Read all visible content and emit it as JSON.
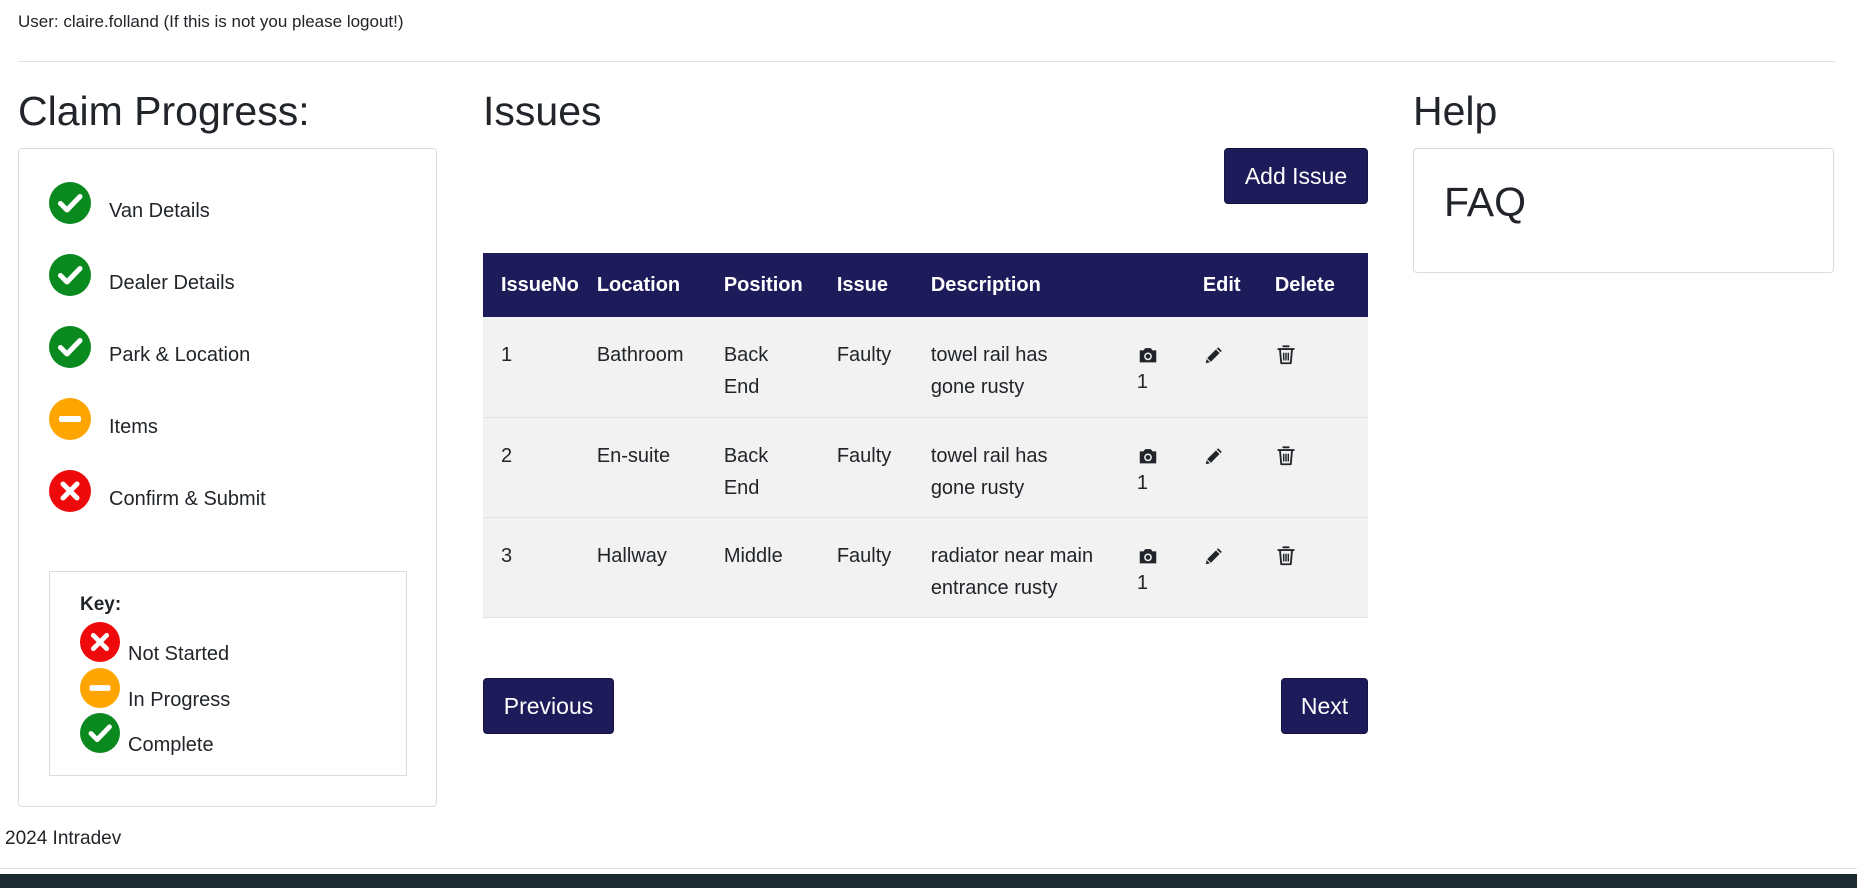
{
  "header": {
    "user_line": "User: claire.folland (If this is not you please logout!)"
  },
  "progress": {
    "title": "Claim Progress:",
    "steps": [
      {
        "label": "Van Details",
        "status": "complete"
      },
      {
        "label": "Dealer Details",
        "status": "complete"
      },
      {
        "label": "Park & Location",
        "status": "complete"
      },
      {
        "label": "Items",
        "status": "in-progress"
      },
      {
        "label": "Confirm & Submit",
        "status": "not-started"
      }
    ],
    "key": {
      "title": "Key:",
      "not_started": "Not Started",
      "in_progress": "In Progress",
      "complete": "Complete"
    }
  },
  "colors": {
    "complete": "#0a8a1e",
    "in_progress": "#ffa500",
    "not_started": "#ee0a0a",
    "primary": "#1e1b5a"
  },
  "issues": {
    "title": "Issues",
    "add_label": "Add Issue",
    "columns": [
      "IssueNo",
      "Location",
      "Position",
      "Issue",
      "Description",
      "",
      "Edit",
      "Delete"
    ],
    "rows": [
      {
        "no": "1",
        "location": "Bathroom",
        "position": "Back End",
        "issue": "Faulty",
        "description": "towel rail has gone rusty",
        "photos": "1"
      },
      {
        "no": "2",
        "location": "En-suite",
        "position": "Back End",
        "issue": "Faulty",
        "description": "towel rail has gone rusty",
        "photos": "1"
      },
      {
        "no": "3",
        "location": "Hallway",
        "position": "Middle",
        "issue": "Faulty",
        "description": "radiator near main entrance rusty",
        "photos": "1"
      }
    ],
    "row_icons": {
      "photo": "camera-icon",
      "edit": "pencil-icon",
      "delete": "trash-icon"
    },
    "previous_label": "Previous",
    "next_label": "Next"
  },
  "help": {
    "title": "Help",
    "faq": "FAQ"
  },
  "footer": {
    "text": "2024 Intradev"
  }
}
